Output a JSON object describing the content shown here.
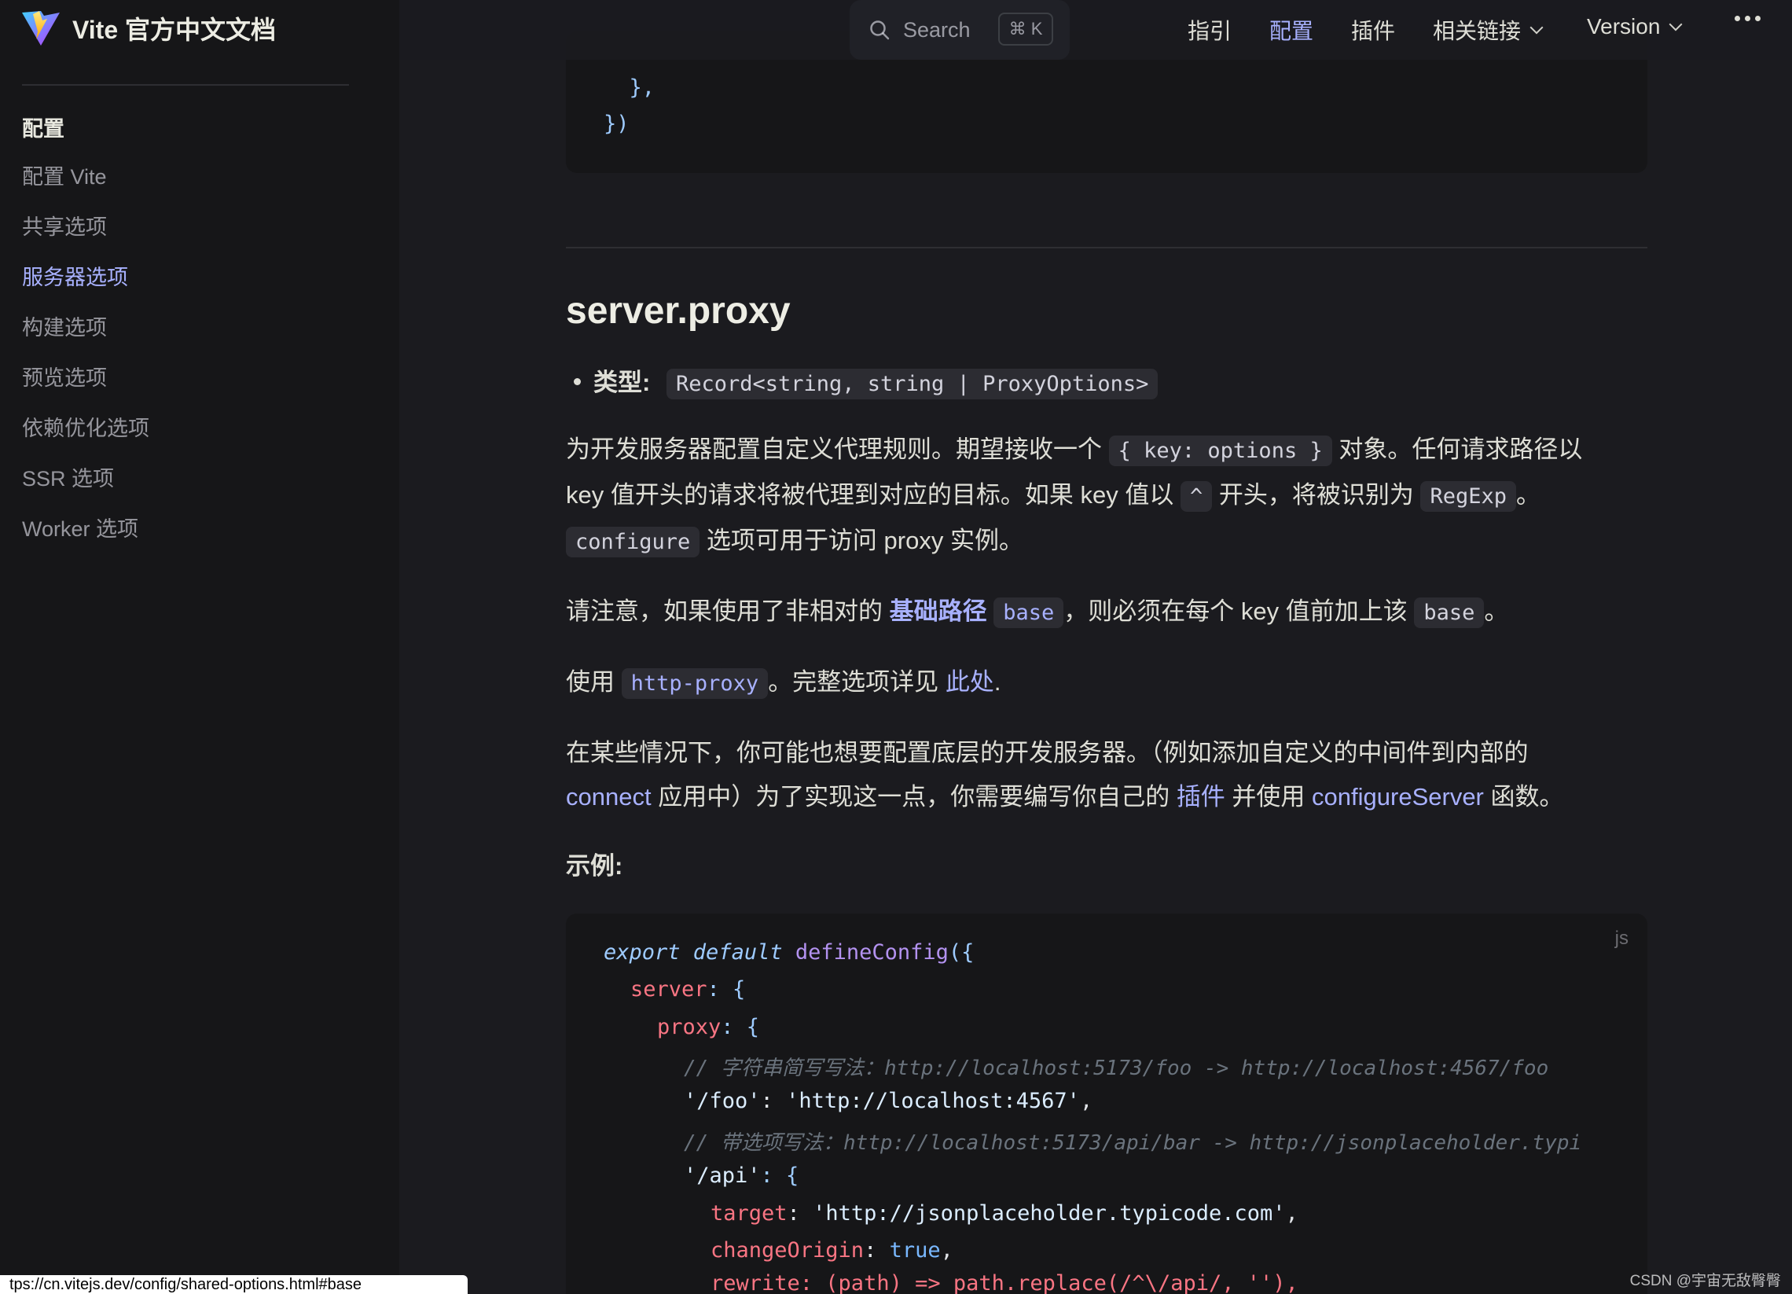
{
  "site": {
    "title": "Vite 官方中文文档"
  },
  "sidebar": {
    "group_title": "配置",
    "items": [
      {
        "label": "配置 Vite",
        "active": false
      },
      {
        "label": "共享选项",
        "active": false
      },
      {
        "label": "服务器选项",
        "active": true
      },
      {
        "label": "构建选项",
        "active": false
      },
      {
        "label": "预览选项",
        "active": false
      },
      {
        "label": "依赖优化选项",
        "active": false
      },
      {
        "label": "SSR 选项",
        "active": false
      },
      {
        "label": "Worker 选项",
        "active": false
      }
    ]
  },
  "search": {
    "label": "Search",
    "shortcut": "⌘ K"
  },
  "nav": {
    "items": [
      {
        "label": "指引"
      },
      {
        "label": "配置"
      },
      {
        "label": "插件"
      },
      {
        "label": "相关链接"
      },
      {
        "label": "Version"
      }
    ]
  },
  "prev_code": {
    "line1": "  },",
    "line2": "})"
  },
  "section": {
    "heading": "server.proxy",
    "type_label": "类型:",
    "type_value": "Record<string, string | ProxyOptions>",
    "p1_a": "为开发服务器配置自定义代理规则。期望接收一个 ",
    "p1_code": "{ key: options }",
    "p1_b": " 对象。任何请求路径以",
    "p2_a": "key 值开头的请求将被代理到对应的目标。如果 key 值以 ",
    "p2_code1": "^",
    "p2_b": " 开头，将被识别为 ",
    "p2_code2": "RegExp",
    "p2_c": "。",
    "p3_code": "configure",
    "p3_b": " 选项可用于访问 proxy 实例。",
    "p4_a": "请注意，如果使用了非相对的 ",
    "p4_link": "基础路径",
    "p4_code1": "base",
    "p4_b": "，则必须在每个 key 值前加上该 ",
    "p4_code2": "base",
    "p4_c": "。",
    "p5_a": "使用 ",
    "p5_code": "http-proxy",
    "p5_b": "。完整选项详见 ",
    "p5_link": "此处",
    "p5_c": ".",
    "p6": "在某些情况下，你可能也想要配置底层的开发服务器。（例如添加自定义的中间件到内部的",
    "p7_link1": "connect",
    "p7_a": " 应用中）为了实现这一点，你需要编写你自己的 ",
    "p7_link2": "插件",
    "p7_b": " 并使用 ",
    "p7_link3": "configureServer",
    "p7_c": " 函数。",
    "example_label": "示例:"
  },
  "code": {
    "lang": "js",
    "l1_a": "export",
    "l1_b": " default",
    "l1_c": " defineConfig",
    "l1_d": "({",
    "l2_a": "server",
    "l2_b": ": {",
    "l3_a": "proxy",
    "l3_b": ": {",
    "l4": "// 字符串简写写法：http://localhost:5173/foo -> http://localhost:4567/foo",
    "l5_a": "'/foo'",
    "l5_b": ": ",
    "l5_c": "'http://localhost:4567'",
    "l5_d": ",",
    "l6": "// 带选项写法：http://localhost:5173/api/bar -> http://jsonplaceholder.typi",
    "l7_a": "'/api'",
    "l7_b": ": {",
    "l8_a": "target",
    "l8_b": ": ",
    "l8_c": "'http://jsonplaceholder.typicode.com'",
    "l8_d": ",",
    "l9_a": "changeOrigin",
    "l9_b": ": ",
    "l9_c": "true",
    "l9_d": ",",
    "l10": "rewrite: (path) => path.replace(/^\\/api/, ''),"
  },
  "status_url": "tps://cn.vitejs.dev/config/shared-options.html#base",
  "watermark": "CSDN @宇宙无敌臀臀",
  "colors": {
    "accent": "#a8b1ff",
    "background": "#1b1b1f",
    "sidebar": "#161618"
  }
}
